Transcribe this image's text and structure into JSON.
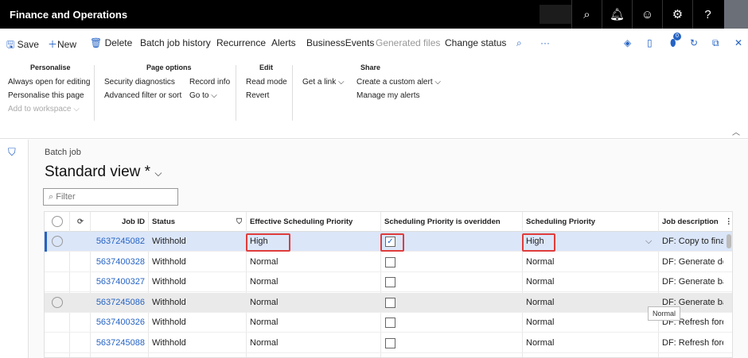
{
  "app": {
    "title": "Finance and Operations"
  },
  "header_icons": [
    "search-icon",
    "bell-icon",
    "smiley-icon",
    "gear-icon",
    "help-icon"
  ],
  "actions": {
    "save": "Save",
    "new": "New",
    "delete": "Delete",
    "batch_job_history": "Batch job history",
    "recurrence": "Recurrence",
    "alerts": "Alerts",
    "business_events": "BusinessEvents",
    "generated_files": "Generated files",
    "change_status": "Change status",
    "badge_count": "0"
  },
  "ribbon": {
    "personalise": {
      "title": "Personalise",
      "items": [
        "Always open for editing",
        "Personalise this page",
        "Add to workspace"
      ]
    },
    "page_options": {
      "title": "Page options",
      "items": [
        "Security diagnostics",
        "Advanced filter or sort",
        "Record info",
        "Go to"
      ]
    },
    "edit": {
      "title": "Edit",
      "items": [
        "Read mode",
        "Revert"
      ]
    },
    "share": {
      "title": "Share",
      "items": [
        "Get a link",
        "Create a custom alert",
        "Manage my alerts"
      ]
    }
  },
  "page": {
    "breadcrumb": "Batch job",
    "view": "Standard view *",
    "filter_placeholder": "Filter"
  },
  "grid": {
    "columns": [
      "Job ID",
      "Status",
      "Effective Scheduling Priority",
      "Scheduling Priority is overidden",
      "Scheduling Priority",
      "Job description"
    ],
    "rows": [
      {
        "job_id": "5637245082",
        "status": "Withhold",
        "effective": "High",
        "overridden": true,
        "priority": "High",
        "description": "DF: Copy to final"
      },
      {
        "job_id": "5637400328",
        "status": "Withhold",
        "effective": "Normal",
        "overridden": false,
        "priority": "Normal",
        "description": "DF: Generate der"
      },
      {
        "job_id": "5637400327",
        "status": "Withhold",
        "effective": "Normal",
        "overridden": false,
        "priority": "Normal",
        "description": "DF: Generate bas"
      },
      {
        "job_id": "5637245086",
        "status": "Withhold",
        "effective": "Normal",
        "overridden": false,
        "priority": "Normal",
        "description": "DF: Generate bas"
      },
      {
        "job_id": "5637400326",
        "status": "Withhold",
        "effective": "Normal",
        "overridden": false,
        "priority": "Normal",
        "description": "DF: Refresh forec"
      },
      {
        "job_id": "5637245088",
        "status": "Withhold",
        "effective": "Normal",
        "overridden": false,
        "priority": "Normal",
        "description": "DF: Refresh forec"
      }
    ]
  },
  "tooltip": "Normal"
}
